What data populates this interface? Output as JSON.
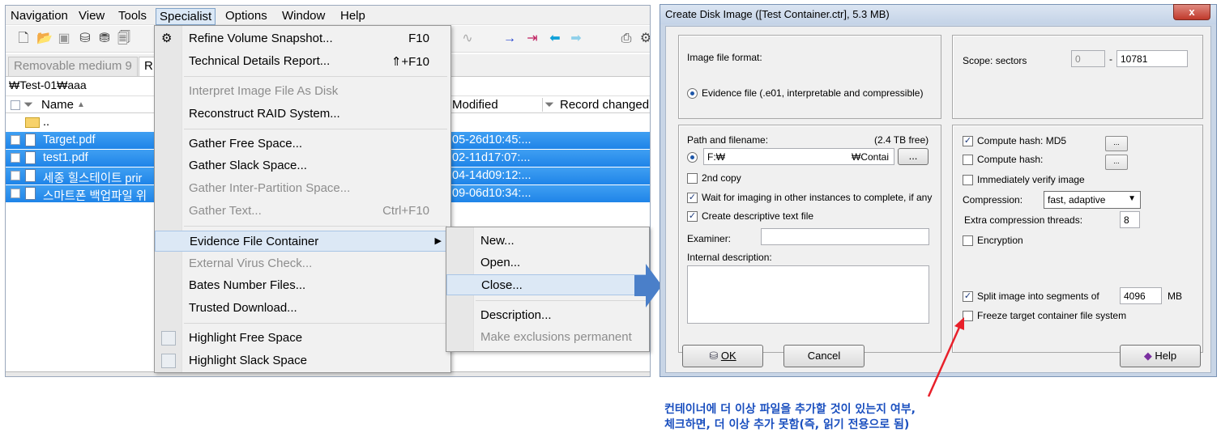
{
  "left_window": {
    "menu": [
      "Navigation",
      "View",
      "Tools",
      "Specialist",
      "Options",
      "Window",
      "Help"
    ],
    "tabs": [
      "Removable medium 9",
      "R"
    ],
    "path": "₩Test-01₩aaa",
    "columns": {
      "name": "Name",
      "modified": "Modified",
      "record_changed": "Record changed"
    },
    "rows": [
      {
        "name": "..",
        "modified": "",
        "type": "folder",
        "selected": false
      },
      {
        "name": "Target.pdf",
        "modified": "05-26d10:45:...",
        "type": "file",
        "selected": true
      },
      {
        "name": "test1.pdf",
        "modified": "02-11d17:07:...",
        "type": "file",
        "selected": true
      },
      {
        "name": "세종 힐스테이트 prir",
        "modified": "04-14d09:12:...",
        "type": "file",
        "selected": true
      },
      {
        "name": "스마트폰 백업파일 위",
        "modified": "09-06d10:34:...",
        "type": "file",
        "selected": true
      }
    ]
  },
  "specialist_menu": {
    "items": [
      {
        "label": "Refine Volume Snapshot...",
        "shortcut": "F10",
        "disabled": false
      },
      {
        "label": "Technical Details Report...",
        "shortcut": "⇑+F10",
        "disabled": false
      },
      {
        "label": "Interpret Image File As Disk",
        "shortcut": "",
        "disabled": true
      },
      {
        "label": "Reconstruct RAID System...",
        "shortcut": "",
        "disabled": false
      },
      {
        "label": "Gather Free Space...",
        "shortcut": "",
        "disabled": false
      },
      {
        "label": "Gather Slack Space...",
        "shortcut": "",
        "disabled": false
      },
      {
        "label": "Gather Inter-Partition Space...",
        "shortcut": "",
        "disabled": true
      },
      {
        "label": "Gather Text...",
        "shortcut": "Ctrl+F10",
        "disabled": true
      },
      {
        "label": "Evidence File Container",
        "shortcut": "",
        "disabled": false
      },
      {
        "label": "External Virus Check...",
        "shortcut": "",
        "disabled": true
      },
      {
        "label": "Bates Number Files...",
        "shortcut": "",
        "disabled": false
      },
      {
        "label": "Trusted Download...",
        "shortcut": "",
        "disabled": false
      },
      {
        "label": "Highlight Free Space",
        "shortcut": "",
        "disabled": false
      },
      {
        "label": "Highlight Slack Space",
        "shortcut": "",
        "disabled": false
      }
    ]
  },
  "container_submenu": {
    "items": [
      {
        "label": "New...",
        "disabled": false
      },
      {
        "label": "Open...",
        "disabled": false
      },
      {
        "label": "Close...",
        "disabled": false
      },
      {
        "label": "Description...",
        "disabled": false
      },
      {
        "label": "Make exclusions permanent",
        "disabled": true
      }
    ]
  },
  "dialog": {
    "title": "Create Disk Image ([Test Container.ctr], 5.3 MB)",
    "close_glyph": "x",
    "image_format_label": "Image file format:",
    "evidence_option": "Evidence file (.e01, interpretable and compressible)",
    "scope_label": "Scope: sectors",
    "scope_from": "0",
    "scope_dash": "-",
    "scope_to": "10781",
    "path_label": "Path and filename:",
    "free_space": "(2.4 TB free)",
    "path_start": "F:₩",
    "path_end": "₩Contai",
    "browse_label": "...",
    "second_copy": "2nd copy",
    "wait_imaging": "Wait for imaging in other instances to complete, if any",
    "create_text_file": "Create descriptive text file",
    "examiner_label": "Examiner:",
    "internal_desc_label": "Internal description:",
    "hash_md5": "Compute hash: MD5",
    "hash_2": "Compute hash:",
    "verify": "Immediately verify image",
    "compression_label": "Compression:",
    "compression_value": "fast, adaptive",
    "threads_label": "Extra compression threads:",
    "threads_value": "8",
    "encryption": "Encryption",
    "split_label": "Split image into segments of",
    "split_value": "4096",
    "split_unit": "MB",
    "freeze": "Freeze target container file system",
    "ok": "OK",
    "cancel": "Cancel",
    "help": "Help"
  },
  "annotation": {
    "line1": "컨테이너에 더 이상 파일을 추가할 것이 있는지 여부,",
    "line2": "체크하면, 더 이상 추가 못함(즉, 읽기 전용으로 됨)"
  },
  "colors": {
    "selection": "#2b8ff0",
    "arrow_blue": "#4a7fc9",
    "red_arrow": "#e8202a",
    "annotation": "#1a4fbf"
  }
}
